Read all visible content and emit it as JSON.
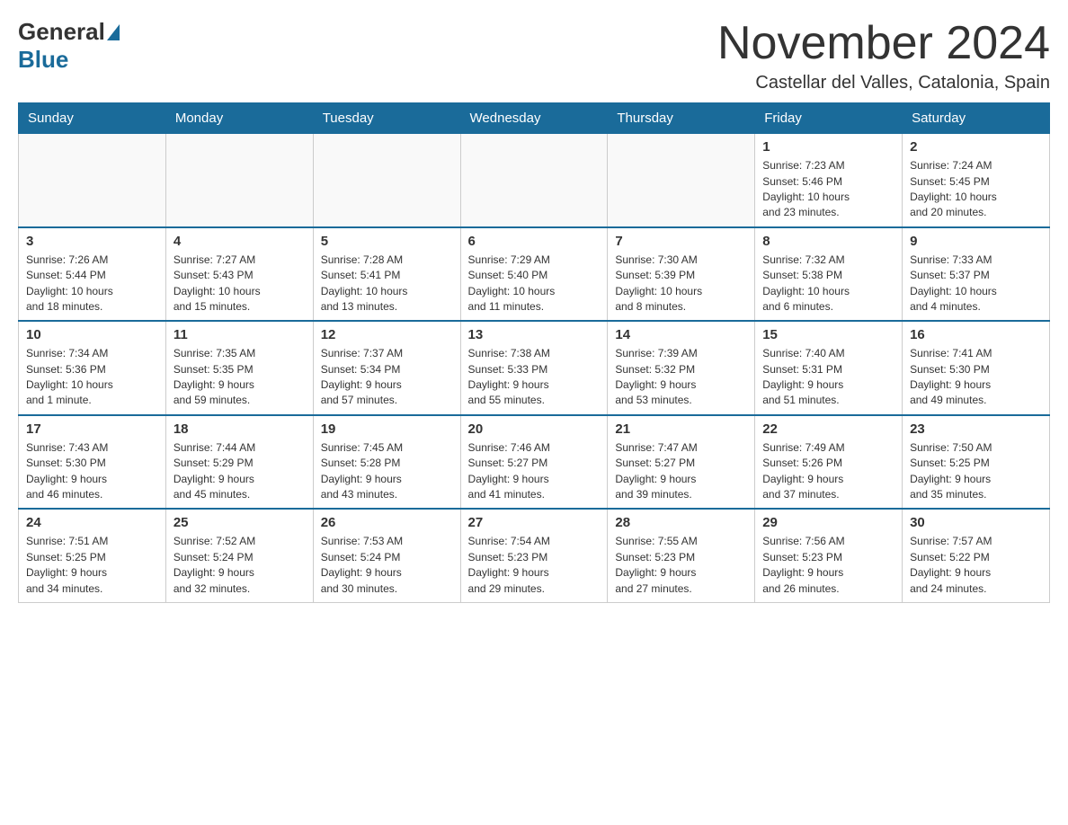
{
  "header": {
    "logo_general": "General",
    "logo_blue": "Blue",
    "month_title": "November 2024",
    "subtitle": "Castellar del Valles, Catalonia, Spain"
  },
  "weekdays": [
    "Sunday",
    "Monday",
    "Tuesday",
    "Wednesday",
    "Thursday",
    "Friday",
    "Saturday"
  ],
  "weeks": [
    [
      {
        "day": "",
        "info": ""
      },
      {
        "day": "",
        "info": ""
      },
      {
        "day": "",
        "info": ""
      },
      {
        "day": "",
        "info": ""
      },
      {
        "day": "",
        "info": ""
      },
      {
        "day": "1",
        "info": "Sunrise: 7:23 AM\nSunset: 5:46 PM\nDaylight: 10 hours\nand 23 minutes."
      },
      {
        "day": "2",
        "info": "Sunrise: 7:24 AM\nSunset: 5:45 PM\nDaylight: 10 hours\nand 20 minutes."
      }
    ],
    [
      {
        "day": "3",
        "info": "Sunrise: 7:26 AM\nSunset: 5:44 PM\nDaylight: 10 hours\nand 18 minutes."
      },
      {
        "day": "4",
        "info": "Sunrise: 7:27 AM\nSunset: 5:43 PM\nDaylight: 10 hours\nand 15 minutes."
      },
      {
        "day": "5",
        "info": "Sunrise: 7:28 AM\nSunset: 5:41 PM\nDaylight: 10 hours\nand 13 minutes."
      },
      {
        "day": "6",
        "info": "Sunrise: 7:29 AM\nSunset: 5:40 PM\nDaylight: 10 hours\nand 11 minutes."
      },
      {
        "day": "7",
        "info": "Sunrise: 7:30 AM\nSunset: 5:39 PM\nDaylight: 10 hours\nand 8 minutes."
      },
      {
        "day": "8",
        "info": "Sunrise: 7:32 AM\nSunset: 5:38 PM\nDaylight: 10 hours\nand 6 minutes."
      },
      {
        "day": "9",
        "info": "Sunrise: 7:33 AM\nSunset: 5:37 PM\nDaylight: 10 hours\nand 4 minutes."
      }
    ],
    [
      {
        "day": "10",
        "info": "Sunrise: 7:34 AM\nSunset: 5:36 PM\nDaylight: 10 hours\nand 1 minute."
      },
      {
        "day": "11",
        "info": "Sunrise: 7:35 AM\nSunset: 5:35 PM\nDaylight: 9 hours\nand 59 minutes."
      },
      {
        "day": "12",
        "info": "Sunrise: 7:37 AM\nSunset: 5:34 PM\nDaylight: 9 hours\nand 57 minutes."
      },
      {
        "day": "13",
        "info": "Sunrise: 7:38 AM\nSunset: 5:33 PM\nDaylight: 9 hours\nand 55 minutes."
      },
      {
        "day": "14",
        "info": "Sunrise: 7:39 AM\nSunset: 5:32 PM\nDaylight: 9 hours\nand 53 minutes."
      },
      {
        "day": "15",
        "info": "Sunrise: 7:40 AM\nSunset: 5:31 PM\nDaylight: 9 hours\nand 51 minutes."
      },
      {
        "day": "16",
        "info": "Sunrise: 7:41 AM\nSunset: 5:30 PM\nDaylight: 9 hours\nand 49 minutes."
      }
    ],
    [
      {
        "day": "17",
        "info": "Sunrise: 7:43 AM\nSunset: 5:30 PM\nDaylight: 9 hours\nand 46 minutes."
      },
      {
        "day": "18",
        "info": "Sunrise: 7:44 AM\nSunset: 5:29 PM\nDaylight: 9 hours\nand 45 minutes."
      },
      {
        "day": "19",
        "info": "Sunrise: 7:45 AM\nSunset: 5:28 PM\nDaylight: 9 hours\nand 43 minutes."
      },
      {
        "day": "20",
        "info": "Sunrise: 7:46 AM\nSunset: 5:27 PM\nDaylight: 9 hours\nand 41 minutes."
      },
      {
        "day": "21",
        "info": "Sunrise: 7:47 AM\nSunset: 5:27 PM\nDaylight: 9 hours\nand 39 minutes."
      },
      {
        "day": "22",
        "info": "Sunrise: 7:49 AM\nSunset: 5:26 PM\nDaylight: 9 hours\nand 37 minutes."
      },
      {
        "day": "23",
        "info": "Sunrise: 7:50 AM\nSunset: 5:25 PM\nDaylight: 9 hours\nand 35 minutes."
      }
    ],
    [
      {
        "day": "24",
        "info": "Sunrise: 7:51 AM\nSunset: 5:25 PM\nDaylight: 9 hours\nand 34 minutes."
      },
      {
        "day": "25",
        "info": "Sunrise: 7:52 AM\nSunset: 5:24 PM\nDaylight: 9 hours\nand 32 minutes."
      },
      {
        "day": "26",
        "info": "Sunrise: 7:53 AM\nSunset: 5:24 PM\nDaylight: 9 hours\nand 30 minutes."
      },
      {
        "day": "27",
        "info": "Sunrise: 7:54 AM\nSunset: 5:23 PM\nDaylight: 9 hours\nand 29 minutes."
      },
      {
        "day": "28",
        "info": "Sunrise: 7:55 AM\nSunset: 5:23 PM\nDaylight: 9 hours\nand 27 minutes."
      },
      {
        "day": "29",
        "info": "Sunrise: 7:56 AM\nSunset: 5:23 PM\nDaylight: 9 hours\nand 26 minutes."
      },
      {
        "day": "30",
        "info": "Sunrise: 7:57 AM\nSunset: 5:22 PM\nDaylight: 9 hours\nand 24 minutes."
      }
    ]
  ]
}
